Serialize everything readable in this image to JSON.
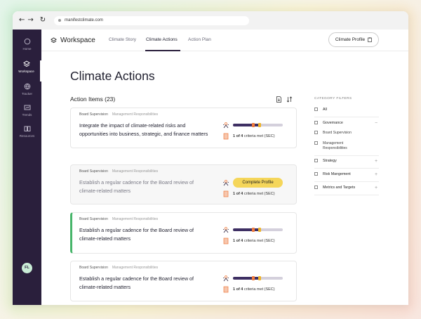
{
  "browser": {
    "url": "manifestclimate.com",
    "back_icon": "arrow-left-icon",
    "forward_icon": "arrow-right-icon",
    "reload_icon": "reload-icon"
  },
  "sidebar": {
    "items": [
      {
        "label": "Home",
        "icon": "home-icon",
        "active": false
      },
      {
        "label": "Workspace",
        "icon": "layers-icon",
        "active": true
      },
      {
        "label": "Tracker",
        "icon": "globe-icon",
        "active": false
      },
      {
        "label": "Trends",
        "icon": "chart-icon",
        "active": false
      },
      {
        "label": "Resources",
        "icon": "book-icon",
        "active": false
      }
    ],
    "avatar": "FL"
  },
  "header": {
    "brand": "Workspace",
    "tabs": [
      {
        "label": "Climate Story",
        "active": false
      },
      {
        "label": "Climate Actions",
        "active": true
      },
      {
        "label": "Action Plan",
        "active": false
      }
    ],
    "profile_button": "Climate Profile"
  },
  "main": {
    "title": "Climate Actions",
    "section": "Action Items (23)"
  },
  "cards": [
    {
      "tag1": "Board Supervision",
      "tag2": "Management Responsibilities",
      "title": "Integrate the impact of climate-related risks and opportunities into business, strategic, and finance matters",
      "criteria_prefix": "1 of 4",
      "criteria_suffix": " criteria met (SEC)",
      "progress": 0.55,
      "muted": false,
      "accent": false
    },
    {
      "tag1": "Board Supervision",
      "tag2": "Management Responsibilities",
      "title": "Establish a regular cadence for the Board review of climate-related matters",
      "criteria_prefix": "1 of 4",
      "criteria_suffix": " criteria met (SEC)",
      "button": "Complete Profile",
      "muted": true,
      "accent": false
    },
    {
      "tag1": "Board Supervision",
      "tag2": "Management Responsibilities",
      "title": "Establish a regular cadence for the Board review of climate-related matters",
      "criteria_prefix": "1 of 4",
      "criteria_suffix": " criteria met (SEC)",
      "progress": 0.55,
      "muted": false,
      "accent": true
    },
    {
      "tag1": "Board Supervision",
      "tag2": "Management Responsibilities",
      "title": "Establish a regular cadence for the Board review of climate-related matters",
      "criteria_prefix": "1 of 4",
      "criteria_suffix": " criteria met (SEC)",
      "progress": 0.55,
      "muted": false,
      "accent": false
    }
  ],
  "filters": {
    "heading": "CATEGORY FILTERS",
    "all": "All",
    "governance": "Governance",
    "board_supervision": "Board Supervision",
    "management_responsibilities": "Management Responsibilities",
    "strategy": "Strategy",
    "risk": "Risk Mangement",
    "metrics": "Metrics and Targets"
  }
}
